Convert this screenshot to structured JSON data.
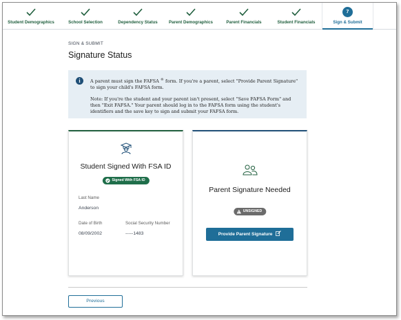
{
  "stepper": {
    "steps": [
      {
        "label": "Student Demographics",
        "state": "complete"
      },
      {
        "label": "School Selection",
        "state": "complete"
      },
      {
        "label": "Dependency Status",
        "state": "complete"
      },
      {
        "label": "Parent Demographics",
        "state": "complete"
      },
      {
        "label": "Parent Financials",
        "state": "complete"
      },
      {
        "label": "Student Financials",
        "state": "complete"
      },
      {
        "label": "Sign & Submit",
        "state": "current",
        "number": "7"
      }
    ]
  },
  "header": {
    "eyebrow": "SIGN & SUBMIT",
    "title": "Signature Status"
  },
  "alert": {
    "icon": "info-icon",
    "line1_pre": "A parent must sign the FAFSA",
    "line1_sup": "®",
    "line1_post": " form. If you're a parent, select \"Provide Parent Signature\" to sign your child's FAFSA form.",
    "note": "Note: If you're the student and your parent isn't present, select \"Save FAFSA Form\" and then \"Exit FAFSA.\" Your parent should log in to the FAFSA form using the student's identifiers and the save key to sign and submit your FAFSA form."
  },
  "student_card": {
    "icon": "graduate-icon",
    "title": "Student Signed With FSA ID",
    "badge": "Signed With FSA ID",
    "last_name_label": "Last Name",
    "last_name_value": "Anderson",
    "dob_label": "Date of Birth",
    "dob_value": "08/09/2002",
    "ssn_label": "Social Security Number",
    "ssn_value": "-----1483"
  },
  "parent_card": {
    "icon": "people-icon",
    "title": "Parent Signature Needed",
    "badge": "UNSIGNED",
    "button_label": "Provide Parent Signature"
  },
  "footer": {
    "previous_label": "Previous"
  },
  "colors": {
    "complete_green": "#1f5e3d",
    "accent_blue": "#1f6e98",
    "alert_bg": "#e6eef4",
    "signed_badge": "#1f6e4a",
    "unsigned_badge": "#6b6b6b"
  }
}
